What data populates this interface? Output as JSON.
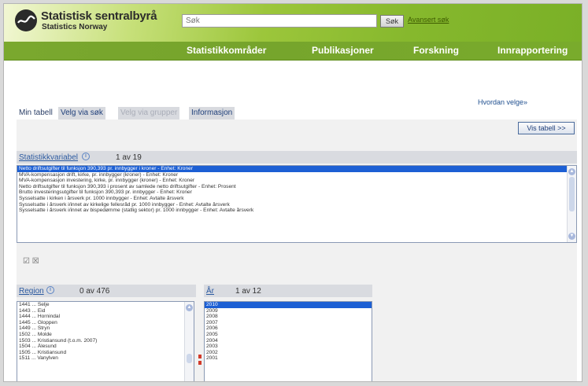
{
  "header": {
    "logo_title": "Statistisk sentralbyrå",
    "logo_subtitle": "Statistics Norway",
    "search_placeholder": "Søk",
    "search_button": "Søk",
    "advanced_search": "Avansert søk"
  },
  "nav": {
    "items": [
      "Statistikkområder",
      "Publikasjoner",
      "Forskning",
      "Innrapportering"
    ]
  },
  "help_link": "Hvordan velge»",
  "tabs": [
    {
      "label": "Min tabell",
      "state": "active"
    },
    {
      "label": "Velg via søk",
      "state": "link"
    },
    {
      "label": "Velg via grupper",
      "state": "disabled"
    },
    {
      "label": "Informasjon",
      "state": "link"
    }
  ],
  "show_table_button": "Vis tabell >>",
  "statistics_variable": {
    "title": "Statistikkvariabel",
    "count": "1  av  19",
    "items": [
      "Netto driftsutgifter til funksjon 390,393 pr. innbygger i kroner   - Enhet: Kroner",
      "MVA-kompensasjon drift, kirke, pr. innbygger (kroner)   - Enhet: Kroner",
      "MVA-kompensasjon investering, kirke, pr. innbygger (kroner)   - Enhet: Kroner",
      "Netto driftsutgifter til funksjon 390,393 i prosent av samlede netto driftsutgifter   - Enhet: Prosent",
      "Brutto investeringsutgifter til funksjon 390,393 pr. innbygger   - Enhet: Kroner",
      "Sysselsatte i kirken i årsverk pr. 1000 innbygger   - Enhet: Avtalte årsverk",
      "Sysselsatte i årsverk i/innet av kirkelige fellesråd pr. 1000 innbygger   - Enhet: Avtalte årsverk",
      "Sysselsatte i årsverk i/innet av bispedømme (statlig sektor) pr. 1000 innbygger   - Enhet: Avtalte årsverk"
    ],
    "selected_index": 0
  },
  "small_icons": "☑ ☒",
  "region": {
    "title": "Region",
    "count": "0  av  476",
    "items": [
      "1441 ... Selje",
      "1443 ... Eid",
      "1444 ... Hornindal",
      "1445 ... Gloppen",
      "1449 ... Stryn",
      "1502 ... Molde",
      "1503 ... Kristiansund (t.o.m. 2007)",
      "1504 ... Ålesund",
      "1505 ... Kristiansund",
      "1511 ... Vanylven"
    ]
  },
  "year": {
    "title": "År",
    "count": "1 av 12",
    "items": [
      "2010",
      "2009",
      "2008",
      "2007",
      "2006",
      "2005",
      "2004",
      "2003",
      "2002",
      "2001"
    ],
    "selected_index": 0
  },
  "colors": {
    "nav_green": "#7aa82e",
    "selection_blue": "#1c5fd4",
    "link_blue": "#2c5aa0"
  }
}
